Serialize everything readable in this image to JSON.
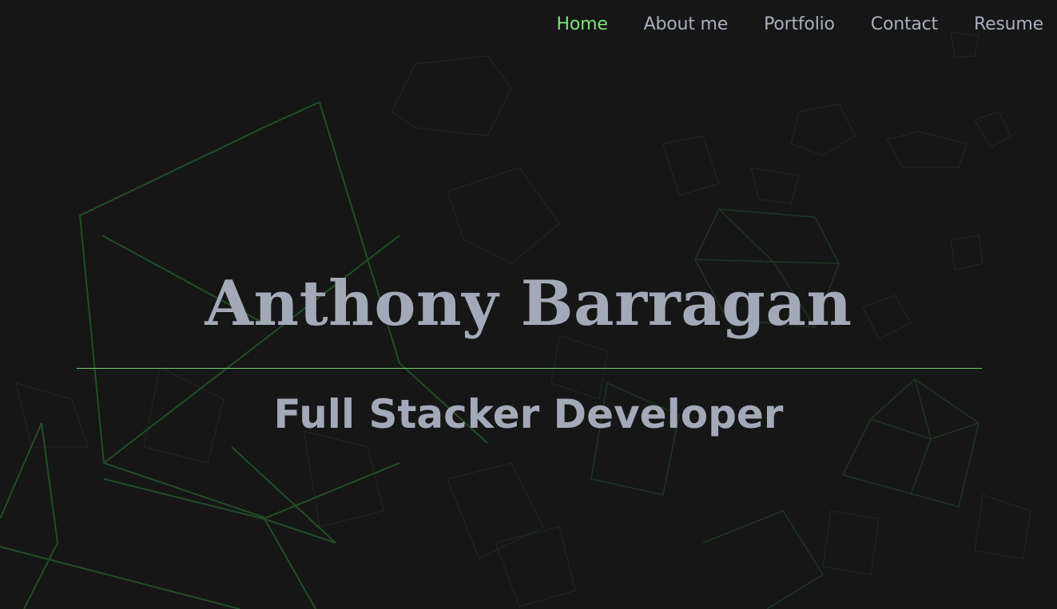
{
  "nav": {
    "items": [
      {
        "label": "Home",
        "active": true
      },
      {
        "label": "About me",
        "active": false
      },
      {
        "label": "Portfolio",
        "active": false
      },
      {
        "label": "Contact",
        "active": false
      },
      {
        "label": "Resume",
        "active": false
      }
    ]
  },
  "hero": {
    "title": "Anthony Barragan",
    "subtitle": "Full Stacker Developer"
  },
  "colors": {
    "background": "#161616",
    "accent": "#7ee27a",
    "text": "#a3a9b6",
    "divider": "#5fd45a"
  }
}
